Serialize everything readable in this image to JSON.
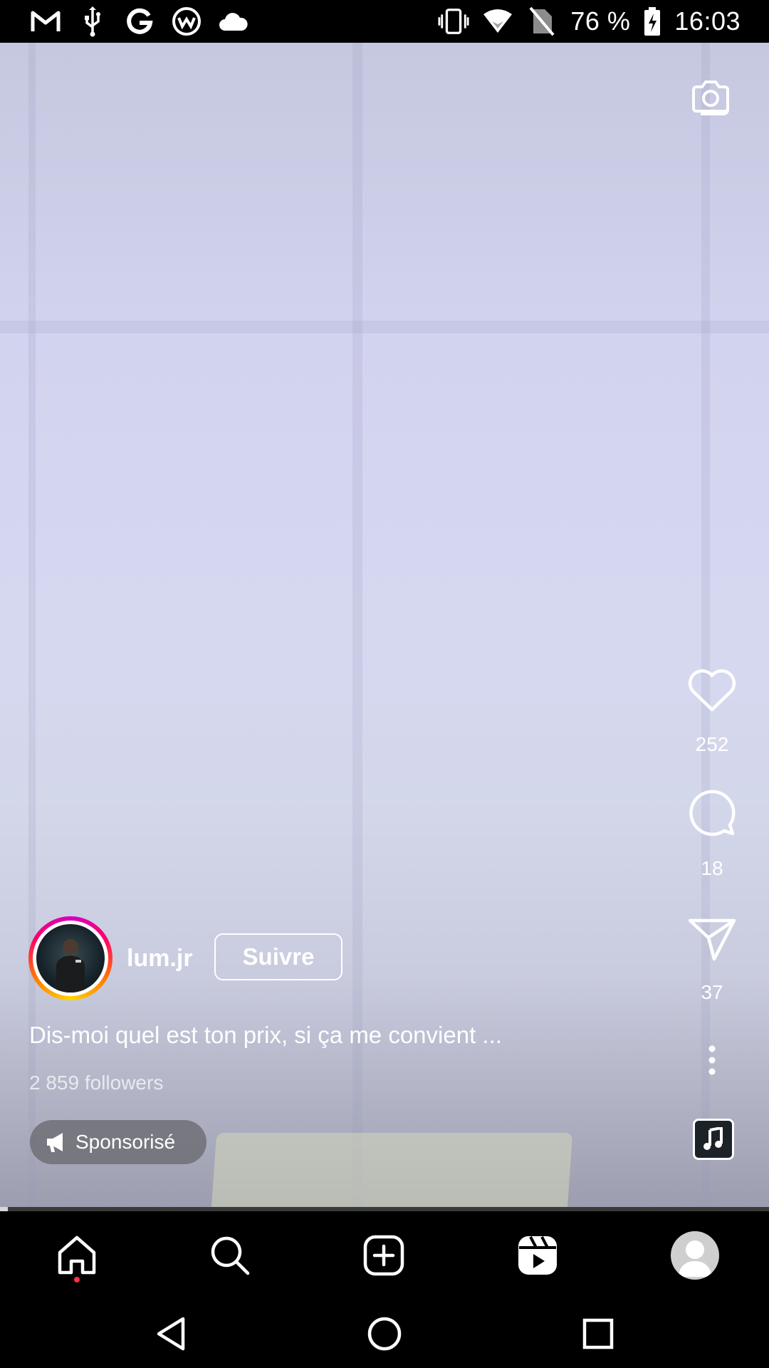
{
  "status_bar": {
    "left_icons": [
      "gmail-icon",
      "usb-icon",
      "google-icon",
      "vpn-icon",
      "cloud-icon"
    ],
    "right_icons": [
      "vibrate-icon",
      "wifi-icon",
      "no-sim-icon"
    ],
    "battery_percent": "76 %",
    "time": "16:03"
  },
  "reel": {
    "progress": 0.01,
    "actions": {
      "likes": "252",
      "comments": "18",
      "shares": "37"
    },
    "author": {
      "username": "lum.jr",
      "follow_label": "Suivre"
    },
    "caption": "Dis-moi quel est ton prix, si ça me convient ...",
    "followers": "2 859 followers",
    "sponsored_label": "Sponsorisé"
  },
  "bottom_nav": {
    "items": [
      "home-icon",
      "search-icon",
      "create-icon",
      "reels-icon",
      "profile-avatar"
    ],
    "active": "home"
  },
  "system_nav": [
    "back-icon",
    "home-circle-icon",
    "recents-icon"
  ],
  "colors": {
    "story_ring": [
      "#d300c5",
      "#ff0069",
      "#ff7a00",
      "#ffd600"
    ],
    "notification_dot": "#ff3040"
  }
}
